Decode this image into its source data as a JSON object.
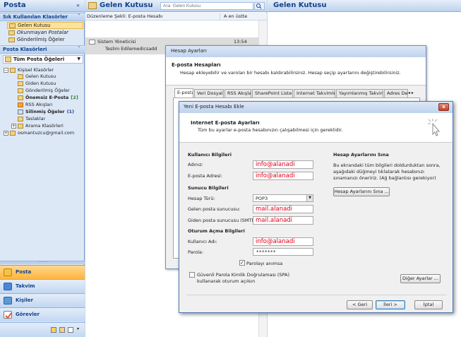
{
  "nav": {
    "title": "Posta",
    "collapse": "«",
    "favorites_header": "Sık Kullanılan Klasörler",
    "favorites_toggle": "˄",
    "favorites": [
      {
        "label": "Gelen Kutusu",
        "italic": false,
        "selected": true
      },
      {
        "label": "Okunmayan Postalar",
        "italic": true,
        "selected": false
      },
      {
        "label": "Gönderilmiş Öğeler",
        "italic": false,
        "selected": false
      }
    ],
    "folders_header": "Posta Klasörleri",
    "folders_toggle": "˄",
    "all_items_label": "Tüm Posta Öğeleri",
    "tree": {
      "personal": "Kişisel Klasörler",
      "items": [
        {
          "label": "Gelen Kutusu",
          "count": "",
          "bold": false
        },
        {
          "label": "Giden Kutusu",
          "count": "",
          "bold": false
        },
        {
          "label": "Gönderilmiş Öğeler",
          "count": "",
          "bold": false
        },
        {
          "label": "Önemsiz E-Posta",
          "count": "[2]",
          "bold": true
        },
        {
          "label": "RSS Akışları",
          "count": "",
          "bold": false
        },
        {
          "label": "Silinmiş Öğeler",
          "count": "(1)",
          "bold": true
        },
        {
          "label": "Taslaklar",
          "count": "",
          "bold": false
        }
      ],
      "search_folders": "Arama Klasörleri",
      "account": "osmantuzcu@gmail.com"
    },
    "buttons": [
      {
        "label": "Posta",
        "active": true,
        "color": "#f7c243"
      },
      {
        "label": "Takvim",
        "active": false,
        "color": "#4a86d9"
      },
      {
        "label": "Kişiler",
        "active": false,
        "color": "#5b9bd5"
      },
      {
        "label": "Görevler",
        "active": false,
        "color": "#e05a3a"
      }
    ]
  },
  "list": {
    "title": "Gelen Kutusu",
    "search_placeholder": "Ara: Gelen Kutusu",
    "arrange_by": "Düzenleme Şekli: E-posta Hesabı",
    "sort": "A en üstte",
    "message": {
      "from": "Sistem Yöneticisi",
      "time": "13:54",
      "subject": "Teslim Edilemedicsadd"
    }
  },
  "reading": {
    "title": "Gelen Kutusu"
  },
  "account_settings": {
    "title": "Hesap Ayarları",
    "heading": "E-posta Hesapları",
    "description": "Hesap ekleyebilir ve varolan bir hesabı kaldırabilirsiniz. Hesap seçip ayarlarını değiştirebilirsiniz.",
    "tabs": [
      "E-posta",
      "Veri Dosyaları",
      "RSS Akışları",
      "SharePoint Listeleri",
      "Internet Takvimleri",
      "Yayımlanmış Takvimler",
      "Adres De"
    ],
    "tab_arrows": "◂ ▸"
  },
  "new_account": {
    "title": "Yeni E-posta Hesabı Ekle",
    "close": "x",
    "heading": "Internet E-posta Ayarları",
    "description": "Tüm bu ayarlar e-posta hesabınızın çalışabilmesi için gereklidir.",
    "user_info": "Kullanıcı Bilgileri",
    "name_label": "Adınız:",
    "name_value": "info@alanadi",
    "email_label": "E-posta Adresi:",
    "email_value": "info@alanadi",
    "server_info": "Sunucu Bilgileri",
    "account_type_label": "Hesap Türü:",
    "account_type_value": "POP3",
    "incoming_label": "Gelen posta sunucusu:",
    "incoming_value": "mail.alanadi",
    "outgoing_label": "Giden posta sunucusu (SMTP):",
    "outgoing_value": "mail.alanadi",
    "logon_info": "Oturum Açma Bilgileri",
    "username_label": "Kullanıcı Adı:",
    "username_value": "info@alanadi",
    "password_label": "Parola:",
    "password_value": "*******",
    "remember_label": "Parolayı anımsa",
    "remember_checked": true,
    "spa_label": "Güvenli Parola Kimlik Doğrulaması (SPA) kullanarak oturum açılsın",
    "spa_checked": false,
    "test_heading": "Hesap Ayarlarını Sına",
    "test_description": "Bu ekrandaki tüm bilgileri doldurduktan sonra, aşağıdaki düğmeyi tıklatarak hesabınızı sınamanızı öneririz. (Ağ bağlantısı gerekiyor)",
    "test_button": "Hesap Ayarlarını Sına ...",
    "more_settings": "Diğer Ayarlar ...",
    "back": "< Geri",
    "next": "İleri >",
    "cancel": "İptal"
  },
  "colors": {
    "accent": "#15428b",
    "field_text": "#e0001b",
    "selected": "#fbe39e"
  }
}
